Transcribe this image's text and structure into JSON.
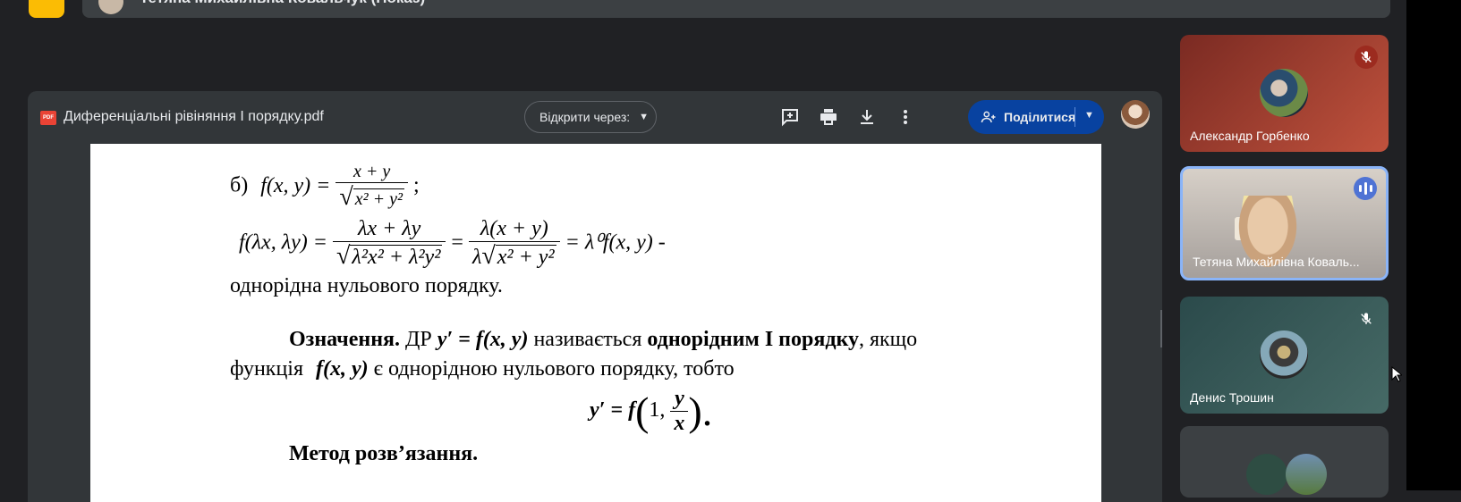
{
  "top_bar": {
    "presenter": "Тетяна Михайлівна Ковальчук (Показ)"
  },
  "viewer": {
    "file_name": "Диференціальні рівіняння І порядку.pdf",
    "pdf_badge": "PDF",
    "open_with": "Відкрити через:",
    "share": "Поділитися",
    "icons": [
      "add-comment-icon",
      "print-icon",
      "download-icon",
      "more-vert-icon",
      "share-people-icon"
    ]
  },
  "document": {
    "line_b_prefix": "б)",
    "line_b_lhs": "f(x, y) =",
    "line_b_num": "x + y",
    "line_b_den": "x² + y²",
    "line_b_end": ";",
    "line2_lhs": "f(λx, λy) =",
    "line2_num1": "λx + λy",
    "line2_den1": "λ²x² + λ²y²",
    "line2_eq": "=",
    "line2_num2": "λ(x + y)",
    "line2_den2_pre": "λ",
    "line2_den2": "x² + y²",
    "line2_rhs": "= λ⁰f(x, y) -",
    "line3": "однорідна нульового порядку.",
    "def_title": "Означення.",
    "def_dr": "ДР",
    "def_eq": "y′ = f(x, y)",
    "def_mid": "називається",
    "def_bold": "однорідним І порядку",
    "def_end": ", якщо",
    "func_word": "функція",
    "func_eq": "f(x, y)",
    "func_rest": "є однорідною нульового порядку, тобто",
    "formula_lhs": "y′ = f",
    "formula_paren_open": "(",
    "formula_one": "1,",
    "formula_num": "y",
    "formula_den": "x",
    "formula_paren_close": ").",
    "method": "Метод розв’язання."
  },
  "participants": [
    {
      "name": "Александр Горбенко",
      "status": "muted"
    },
    {
      "name": "Тетяна Михайлівна Коваль...",
      "status": "speaking"
    },
    {
      "name": "Денис Трошин",
      "status": "muted"
    }
  ]
}
